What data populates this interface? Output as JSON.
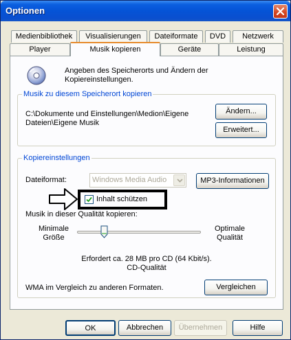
{
  "window": {
    "title": "Optionen",
    "close_icon": "close-icon"
  },
  "tabs": {
    "row1": [
      "Medienbibliothek",
      "Visualisierungen",
      "Dateiformate",
      "DVD",
      "Netzwerk"
    ],
    "row2": [
      "Player",
      "Musik kopieren",
      "Geräte",
      "Leistung"
    ],
    "active": "Musik kopieren"
  },
  "intro": {
    "icon": "cd-icon",
    "text": "Angeben des Speicherorts und Ändern der Kopiereinstellungen."
  },
  "location_group": {
    "title": "Musik zu diesem Speicherort kopieren",
    "path": "C:\\Dokumente und Einstellungen\\Medion\\Eigene Dateien\\Eigene Musik",
    "change_button": "Ändern...",
    "advanced_button": "Erweitert..."
  },
  "copy_settings": {
    "title": "Kopiereinstellungen",
    "format_label": "Dateiformat:",
    "format_value": "Windows Media Audio",
    "mp3_button": "MP3-Informationen",
    "protect_label": "Inhalt schützen",
    "protect_checked": true,
    "quality_label": "Musik in dieser Qualität kopieren:",
    "min_label": "Minimale Größe",
    "max_label": "Optimale Qualität",
    "quality_level": 0.22,
    "requirement_line1": "Erfordert ca. 28 MB pro CD (64 Kbit/s).",
    "requirement_line2": "CD-Qualität",
    "compare_label": "WMA im Vergleich zu anderen Formaten.",
    "compare_button": "Vergleichen"
  },
  "footer": {
    "ok": "OK",
    "cancel": "Abbrechen",
    "apply": "Übernehmen",
    "help": "Hilfe"
  },
  "colors": {
    "title_bar": "#0553d6",
    "group_title": "#0046d5",
    "active_tab_accent": "#e68b2c",
    "dialog_bg": "#ece9d8"
  }
}
